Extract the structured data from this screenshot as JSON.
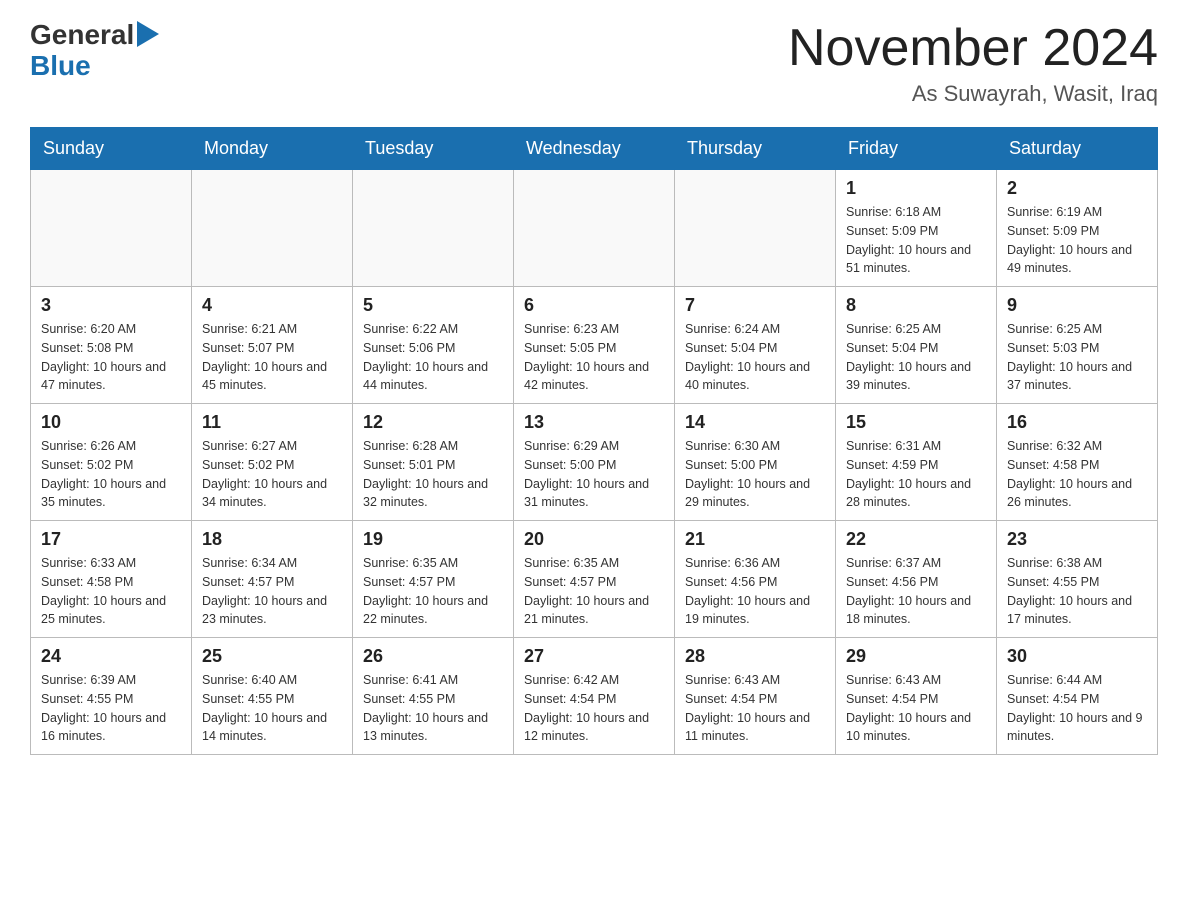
{
  "header": {
    "logo": {
      "general": "General",
      "blue": "Blue",
      "arrow": "▶"
    },
    "title": "November 2024",
    "location": "As Suwayrah, Wasit, Iraq"
  },
  "weekdays": [
    "Sunday",
    "Monday",
    "Tuesday",
    "Wednesday",
    "Thursday",
    "Friday",
    "Saturday"
  ],
  "weeks": [
    [
      {
        "day": "",
        "sunrise": "",
        "sunset": "",
        "daylight": ""
      },
      {
        "day": "",
        "sunrise": "",
        "sunset": "",
        "daylight": ""
      },
      {
        "day": "",
        "sunrise": "",
        "sunset": "",
        "daylight": ""
      },
      {
        "day": "",
        "sunrise": "",
        "sunset": "",
        "daylight": ""
      },
      {
        "day": "",
        "sunrise": "",
        "sunset": "",
        "daylight": ""
      },
      {
        "day": "1",
        "sunrise": "Sunrise: 6:18 AM",
        "sunset": "Sunset: 5:09 PM",
        "daylight": "Daylight: 10 hours and 51 minutes."
      },
      {
        "day": "2",
        "sunrise": "Sunrise: 6:19 AM",
        "sunset": "Sunset: 5:09 PM",
        "daylight": "Daylight: 10 hours and 49 minutes."
      }
    ],
    [
      {
        "day": "3",
        "sunrise": "Sunrise: 6:20 AM",
        "sunset": "Sunset: 5:08 PM",
        "daylight": "Daylight: 10 hours and 47 minutes."
      },
      {
        "day": "4",
        "sunrise": "Sunrise: 6:21 AM",
        "sunset": "Sunset: 5:07 PM",
        "daylight": "Daylight: 10 hours and 45 minutes."
      },
      {
        "day": "5",
        "sunrise": "Sunrise: 6:22 AM",
        "sunset": "Sunset: 5:06 PM",
        "daylight": "Daylight: 10 hours and 44 minutes."
      },
      {
        "day": "6",
        "sunrise": "Sunrise: 6:23 AM",
        "sunset": "Sunset: 5:05 PM",
        "daylight": "Daylight: 10 hours and 42 minutes."
      },
      {
        "day": "7",
        "sunrise": "Sunrise: 6:24 AM",
        "sunset": "Sunset: 5:04 PM",
        "daylight": "Daylight: 10 hours and 40 minutes."
      },
      {
        "day": "8",
        "sunrise": "Sunrise: 6:25 AM",
        "sunset": "Sunset: 5:04 PM",
        "daylight": "Daylight: 10 hours and 39 minutes."
      },
      {
        "day": "9",
        "sunrise": "Sunrise: 6:25 AM",
        "sunset": "Sunset: 5:03 PM",
        "daylight": "Daylight: 10 hours and 37 minutes."
      }
    ],
    [
      {
        "day": "10",
        "sunrise": "Sunrise: 6:26 AM",
        "sunset": "Sunset: 5:02 PM",
        "daylight": "Daylight: 10 hours and 35 minutes."
      },
      {
        "day": "11",
        "sunrise": "Sunrise: 6:27 AM",
        "sunset": "Sunset: 5:02 PM",
        "daylight": "Daylight: 10 hours and 34 minutes."
      },
      {
        "day": "12",
        "sunrise": "Sunrise: 6:28 AM",
        "sunset": "Sunset: 5:01 PM",
        "daylight": "Daylight: 10 hours and 32 minutes."
      },
      {
        "day": "13",
        "sunrise": "Sunrise: 6:29 AM",
        "sunset": "Sunset: 5:00 PM",
        "daylight": "Daylight: 10 hours and 31 minutes."
      },
      {
        "day": "14",
        "sunrise": "Sunrise: 6:30 AM",
        "sunset": "Sunset: 5:00 PM",
        "daylight": "Daylight: 10 hours and 29 minutes."
      },
      {
        "day": "15",
        "sunrise": "Sunrise: 6:31 AM",
        "sunset": "Sunset: 4:59 PM",
        "daylight": "Daylight: 10 hours and 28 minutes."
      },
      {
        "day": "16",
        "sunrise": "Sunrise: 6:32 AM",
        "sunset": "Sunset: 4:58 PM",
        "daylight": "Daylight: 10 hours and 26 minutes."
      }
    ],
    [
      {
        "day": "17",
        "sunrise": "Sunrise: 6:33 AM",
        "sunset": "Sunset: 4:58 PM",
        "daylight": "Daylight: 10 hours and 25 minutes."
      },
      {
        "day": "18",
        "sunrise": "Sunrise: 6:34 AM",
        "sunset": "Sunset: 4:57 PM",
        "daylight": "Daylight: 10 hours and 23 minutes."
      },
      {
        "day": "19",
        "sunrise": "Sunrise: 6:35 AM",
        "sunset": "Sunset: 4:57 PM",
        "daylight": "Daylight: 10 hours and 22 minutes."
      },
      {
        "day": "20",
        "sunrise": "Sunrise: 6:35 AM",
        "sunset": "Sunset: 4:57 PM",
        "daylight": "Daylight: 10 hours and 21 minutes."
      },
      {
        "day": "21",
        "sunrise": "Sunrise: 6:36 AM",
        "sunset": "Sunset: 4:56 PM",
        "daylight": "Daylight: 10 hours and 19 minutes."
      },
      {
        "day": "22",
        "sunrise": "Sunrise: 6:37 AM",
        "sunset": "Sunset: 4:56 PM",
        "daylight": "Daylight: 10 hours and 18 minutes."
      },
      {
        "day": "23",
        "sunrise": "Sunrise: 6:38 AM",
        "sunset": "Sunset: 4:55 PM",
        "daylight": "Daylight: 10 hours and 17 minutes."
      }
    ],
    [
      {
        "day": "24",
        "sunrise": "Sunrise: 6:39 AM",
        "sunset": "Sunset: 4:55 PM",
        "daylight": "Daylight: 10 hours and 16 minutes."
      },
      {
        "day": "25",
        "sunrise": "Sunrise: 6:40 AM",
        "sunset": "Sunset: 4:55 PM",
        "daylight": "Daylight: 10 hours and 14 minutes."
      },
      {
        "day": "26",
        "sunrise": "Sunrise: 6:41 AM",
        "sunset": "Sunset: 4:55 PM",
        "daylight": "Daylight: 10 hours and 13 minutes."
      },
      {
        "day": "27",
        "sunrise": "Sunrise: 6:42 AM",
        "sunset": "Sunset: 4:54 PM",
        "daylight": "Daylight: 10 hours and 12 minutes."
      },
      {
        "day": "28",
        "sunrise": "Sunrise: 6:43 AM",
        "sunset": "Sunset: 4:54 PM",
        "daylight": "Daylight: 10 hours and 11 minutes."
      },
      {
        "day": "29",
        "sunrise": "Sunrise: 6:43 AM",
        "sunset": "Sunset: 4:54 PM",
        "daylight": "Daylight: 10 hours and 10 minutes."
      },
      {
        "day": "30",
        "sunrise": "Sunrise: 6:44 AM",
        "sunset": "Sunset: 4:54 PM",
        "daylight": "Daylight: 10 hours and 9 minutes."
      }
    ]
  ]
}
